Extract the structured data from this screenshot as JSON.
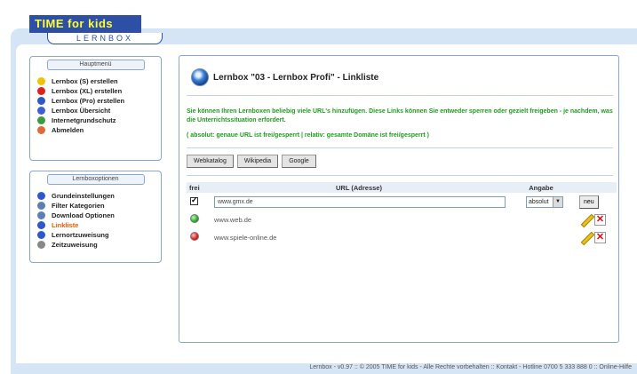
{
  "brand": {
    "logo_text": "TIME for kids",
    "sub_logo": "LERNBOX"
  },
  "sidebar": {
    "menu_title": "Hauptmenü",
    "menu_items": [
      {
        "label": "Lernbox (S) erstellen",
        "icon": "yellow-box-icon",
        "color": "#f2c200"
      },
      {
        "label": "Lernbox (XL) erstellen",
        "icon": "red-box-icon",
        "color": "#d92323"
      },
      {
        "label": "Lernbox (Pro) erstellen",
        "icon": "blue-box-icon",
        "color": "#2c59c9"
      },
      {
        "label": "Lernbox Übersicht",
        "icon": "overview-icon",
        "color": "#3d5fd0"
      },
      {
        "label": "Internetgrundschutz",
        "icon": "info-icon",
        "color": "#3a9c3a"
      },
      {
        "label": "Abmelden",
        "icon": "logout-icon",
        "color": "#e06a3a"
      }
    ],
    "options_title": "Lernboxoptionen",
    "option_items": [
      {
        "label": "Grundeinstellungen",
        "icon": "settings-icon",
        "color": "#2c59c9",
        "active": false
      },
      {
        "label": "Filter Kategorien",
        "icon": "filter-icon",
        "color": "#5c7fb5",
        "active": false
      },
      {
        "label": "Download Optionen",
        "icon": "download-icon",
        "color": "#5c7fb5",
        "active": false
      },
      {
        "label": "Linkliste",
        "icon": "globe-icon",
        "color": "#2c59c9",
        "active": true
      },
      {
        "label": "Lernortzuweisung",
        "icon": "location-icon",
        "color": "#2c59c9",
        "active": false
      },
      {
        "label": "Zeitzuweisung",
        "icon": "clock-icon",
        "color": "#888888",
        "active": false
      }
    ]
  },
  "main": {
    "title": "Lernbox \"03 - Lernbox Profi\" - Linkliste",
    "intro": "Sie können Ihren Lernboxen beliebig viele URL's hinzufügen. Diese Links können Sie entweder sperren oder gezielt freigeben - je nachdem, was die Unterrichtssituation erfordert.",
    "legend": "( absolut: genaue URL ist frei/gesperrt | relativ: gesamte Domäne ist frei/gesperrt )",
    "buttons": [
      "Webkatalog",
      "Wikipedia",
      "Google"
    ],
    "table": {
      "headers": {
        "frei": "frei",
        "url": "URL (Adresse)",
        "angabe": "Angabe"
      },
      "new_row": {
        "url_value": "www.gmx.de",
        "angabe_value": "absolut",
        "add_label": "neu"
      },
      "rows": [
        {
          "url": "www.web.de",
          "status": "green"
        },
        {
          "url": "www.spiele-online.de",
          "status": "red"
        }
      ]
    }
  },
  "footer": {
    "text": "Lernbox - v0.97 :: © 2005 TIME for kids - Alle Rechte vorbehalten :: Kontakt - Hotline 0700 5 333 888 0 :: Online-Hilfe"
  },
  "colors": {
    "frame": "#d6e5f5",
    "accent": "#2d4fa6",
    "green_text": "#1d9e1d",
    "active_link": "#e65c00"
  }
}
